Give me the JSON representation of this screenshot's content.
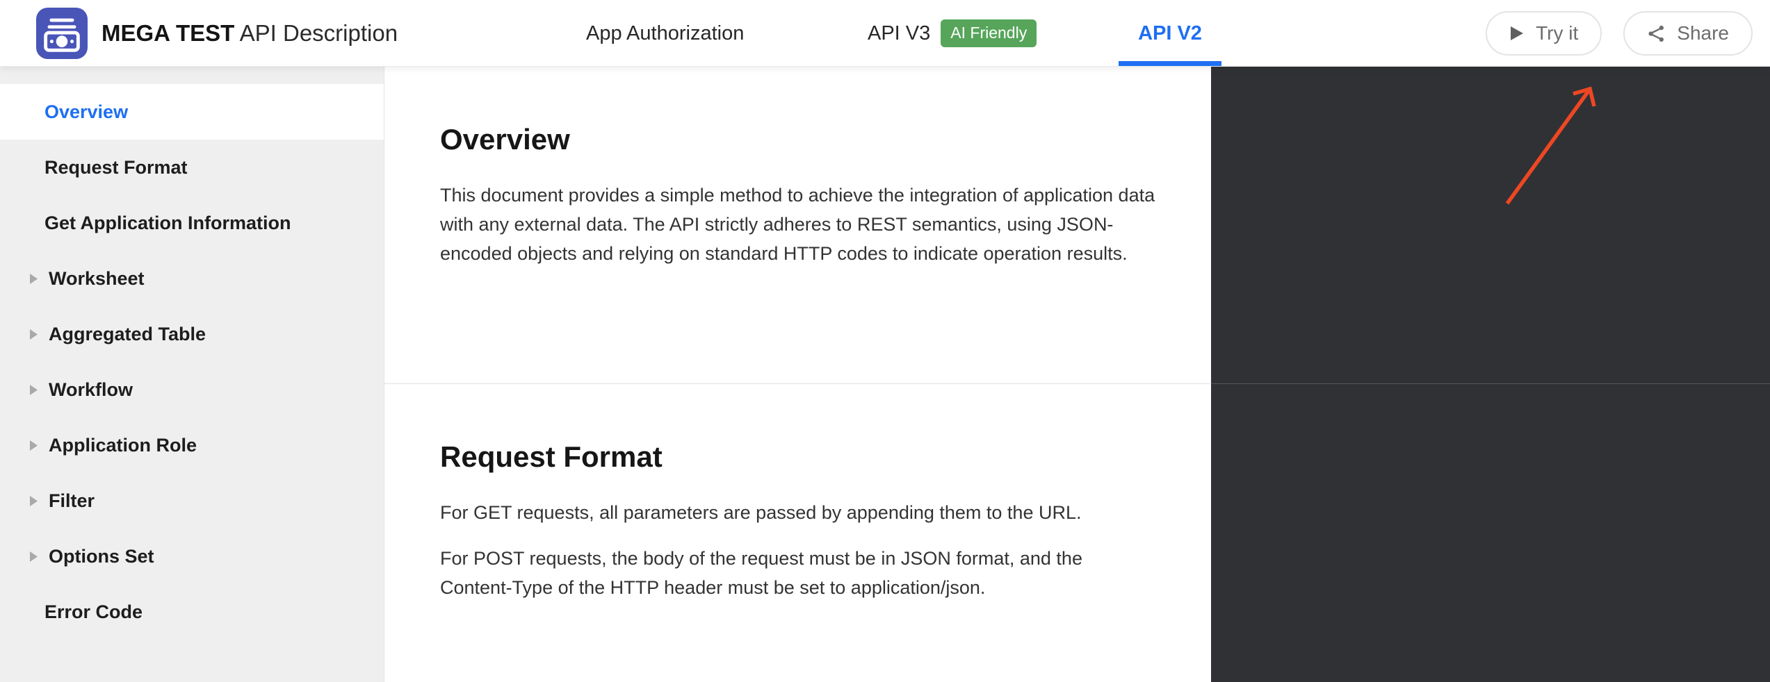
{
  "header": {
    "brand_bold": "MEGA TEST",
    "brand_regular": "API Description",
    "nav": [
      {
        "label": "App Authorization",
        "active": false
      },
      {
        "label": "API V3",
        "badge": "AI Friendly",
        "active": false
      },
      {
        "label": "API V2",
        "active": true
      }
    ],
    "actions": [
      {
        "label": "Try it",
        "icon": "play-icon"
      },
      {
        "label": "Share",
        "icon": "share-icon"
      }
    ]
  },
  "sidebar": {
    "items": [
      {
        "label": "Overview",
        "active": true,
        "expandable": false
      },
      {
        "label": "Request Format",
        "active": false,
        "expandable": false
      },
      {
        "label": "Get Application Information",
        "active": false,
        "expandable": false
      },
      {
        "label": "Worksheet",
        "active": false,
        "expandable": true
      },
      {
        "label": "Aggregated Table",
        "active": false,
        "expandable": true
      },
      {
        "label": "Workflow",
        "active": false,
        "expandable": true
      },
      {
        "label": "Application Role",
        "active": false,
        "expandable": true
      },
      {
        "label": "Filter",
        "active": false,
        "expandable": true
      },
      {
        "label": "Options Set",
        "active": false,
        "expandable": true
      },
      {
        "label": "Error Code",
        "active": false,
        "expandable": false
      }
    ]
  },
  "sections": [
    {
      "heading": "Overview",
      "paragraphs": [
        "This document provides a simple method to achieve the integration of application data with any external data. The API strictly adheres to REST semantics, using JSON-encoded objects and relying on standard HTTP codes to indicate operation results."
      ]
    },
    {
      "heading": "Request Format",
      "paragraphs": [
        "For GET requests, all parameters are passed by appending them to the URL.",
        "For POST requests, the body of the request must be in JSON format, and the Content-Type of the HTTP header must be set to application/json."
      ]
    }
  ],
  "annotation": {
    "type": "arrow",
    "color": "#ee4723"
  },
  "colors": {
    "accent_blue": "#1e6ff2",
    "badge_green": "#56a55a",
    "logo_indigo": "#4a55b8",
    "code_panel_dark": "#303135",
    "sidebar_gray": "#efefef",
    "arrow_red": "#ee4723"
  }
}
